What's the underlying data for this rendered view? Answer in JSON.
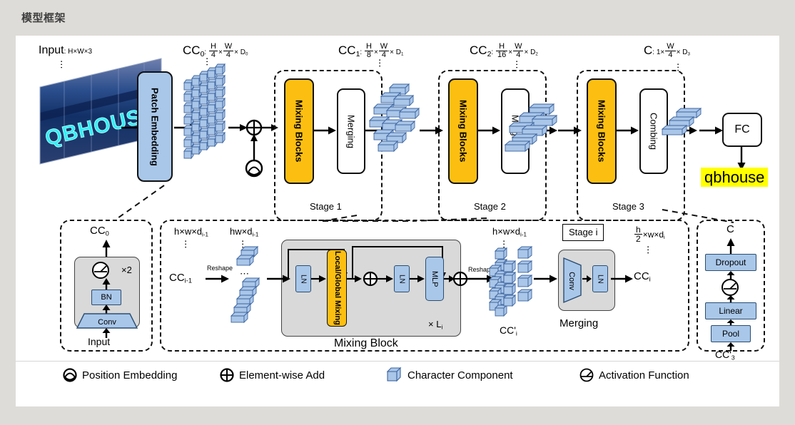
{
  "page": {
    "title": "模型框架"
  },
  "colors": {
    "background": "#dedcd8",
    "card": "#ffffff",
    "orange": "#fcbf11",
    "blue": "#a9c7e9",
    "gray": "#d9d9d9",
    "highlight": "#ffff00",
    "stroke": "#111111"
  },
  "top_flow": {
    "input_label": "Input",
    "input_shape": ": H×W×3",
    "input_image_text": "QBHOUSE",
    "patch_embedding": "Patch Embedding",
    "cc0_label": "CC",
    "cc0_sub": "0",
    "cc0_shape_pre": ": ",
    "cc0_num1": "H",
    "cc0_den1": "4",
    "cc0_num2": "W",
    "cc0_den2": "4",
    "cc0_tail": "× D",
    "cc0_tail_sub": "0",
    "cc1_label": "CC",
    "cc1_sub": "1",
    "cc1_num1": "H",
    "cc1_den1": "8",
    "cc1_num2": "W",
    "cc1_den2": "4",
    "cc1_tail": "× D",
    "cc1_tail_sub": "1",
    "cc2_label": "CC",
    "cc2_sub": "2",
    "cc2_num1": "H",
    "cc2_den1": "16",
    "cc2_num2": "W",
    "cc2_den2": "4",
    "cc2_tail": "× D",
    "cc2_tail_sub": "2",
    "c_label": "C",
    "c_pre": ": 1×",
    "c_num": "W",
    "c_den": "4",
    "c_tail": "× D",
    "c_tail_sub": "3",
    "stages": [
      {
        "caption": "Stage 1",
        "block_a": "Mixing  Blocks",
        "block_b": "Merging"
      },
      {
        "caption": "Stage 2",
        "block_a": "Mixing  Blocks",
        "block_b": "Merging"
      },
      {
        "caption": "Stage 3",
        "block_a": "Mixing  Blocks",
        "block_b": "Combing"
      }
    ],
    "fc_label": "FC",
    "prediction": "qbhouse"
  },
  "detail_patch": {
    "output_label": "CC",
    "output_sub": "0",
    "repeat": "×2",
    "bn": "BN",
    "conv": "Conv",
    "input": "Input"
  },
  "detail_mixing": {
    "in_shape": "h×w×d",
    "in_shape_sub": "i-1",
    "seq_shape": "hw×d",
    "seq_shape_sub": "i-1",
    "cc_in": "CC",
    "cc_in_sub": "i-1",
    "reshape_in": "Reshape",
    "ln1": "LN",
    "mixing": "Local/Global Mixing",
    "ln2": "LN",
    "mlp": "MLP",
    "repeat": "× L",
    "repeat_sub": "i",
    "block_caption": "Mixing Block",
    "reshape_out": "Reshape",
    "out_shape": "h×w×d",
    "out_shape_sub": "i-1",
    "cc_prime": "CC'",
    "cc_prime_sub": "i",
    "stage_tag": "Stage i",
    "merge_shape_num": "h",
    "merge_shape_den": "2",
    "merge_shape_tail": "×w×d",
    "merge_shape_tail_sub": "i",
    "merge_conv": "Conv",
    "merge_ln": "LN",
    "merge_caption": "Merging",
    "cc_out": "CC",
    "cc_out_sub": "i"
  },
  "detail_combing": {
    "output": "C",
    "dropout": "Dropout",
    "linear": "Linear",
    "pool": "Pool",
    "input": "CC'",
    "input_sub": "3"
  },
  "legend": {
    "items": [
      {
        "icon": "position-embedding-icon",
        "label": "Position Embedding"
      },
      {
        "icon": "element-wise-add-icon",
        "label": "Element-wise Add"
      },
      {
        "icon": "character-component-icon",
        "label": "Character Component"
      },
      {
        "icon": "activation-function-icon",
        "label": "Activation Function"
      }
    ]
  }
}
